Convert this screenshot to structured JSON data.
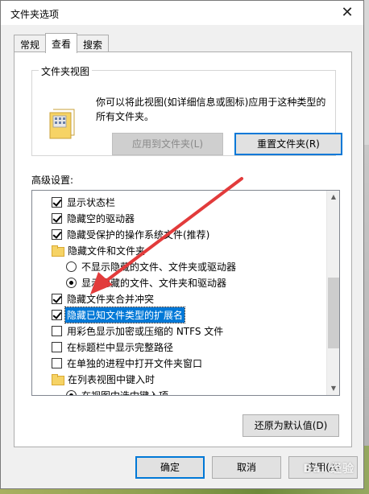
{
  "window": {
    "title": "文件夹选项",
    "close_icon": "close-icon"
  },
  "tabs": [
    {
      "label": "常规",
      "active": false
    },
    {
      "label": "查看",
      "active": true
    },
    {
      "label": "搜索",
      "active": false
    }
  ],
  "folder_views": {
    "group_label": "文件夹视图",
    "description": "你可以将此视图(如详细信息或图标)应用于这种类型的所有文件夹。",
    "apply_button": "应用到文件夹(L)",
    "reset_button": "重置文件夹(R)"
  },
  "advanced": {
    "label": "高级设置:",
    "items": [
      {
        "type": "checkbox",
        "checked": true,
        "label": "显示状态栏"
      },
      {
        "type": "checkbox",
        "checked": true,
        "label": "隐藏空的驱动器"
      },
      {
        "type": "checkbox",
        "checked": true,
        "label": "隐藏受保护的操作系统文件(推荐)"
      },
      {
        "type": "folder",
        "label": "隐藏文件和文件夹"
      },
      {
        "type": "radio",
        "checked": false,
        "label": "不显示隐藏的文件、文件夹或驱动器"
      },
      {
        "type": "radio",
        "checked": true,
        "label": "显示隐藏的文件、文件夹和驱动器"
      },
      {
        "type": "checkbox",
        "checked": true,
        "label": "隐藏文件夹合并冲突"
      },
      {
        "type": "checkbox",
        "checked": true,
        "label": "隐藏已知文件类型的扩展名",
        "selected": true
      },
      {
        "type": "checkbox",
        "checked": false,
        "label": "用彩色显示加密或压缩的 NTFS 文件"
      },
      {
        "type": "checkbox",
        "checked": false,
        "label": "在标题栏中显示完整路径"
      },
      {
        "type": "checkbox",
        "checked": false,
        "label": "在单独的进程中打开文件夹窗口"
      },
      {
        "type": "folder",
        "label": "在列表视图中键入时"
      },
      {
        "type": "radio",
        "checked": true,
        "label": "在视图中选中键入项"
      }
    ],
    "restore_button": "还原为默认值(D)"
  },
  "footer": {
    "ok": "确定",
    "cancel": "取消",
    "apply": "应用(A)"
  },
  "watermark": "Bai 经验",
  "colors": {
    "accent": "#0078d7",
    "arrow": "#e23b3b"
  }
}
